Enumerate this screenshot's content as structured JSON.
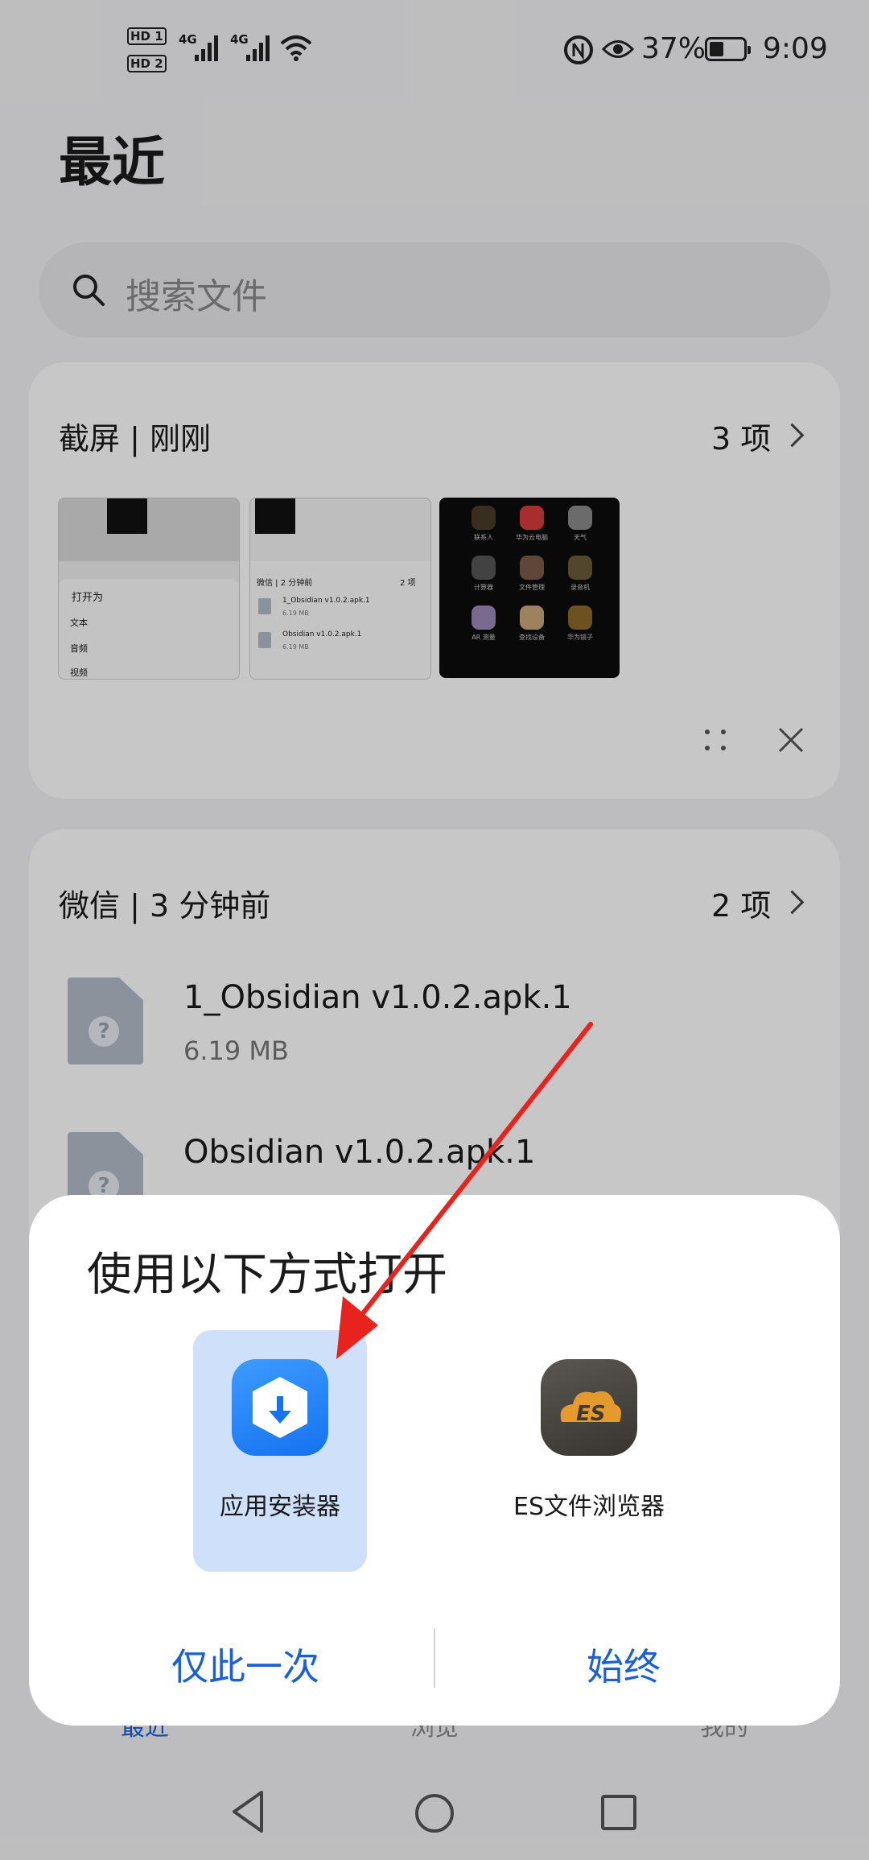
{
  "status_bar": {
    "sim1": "HD 1",
    "sim2": "HD 2",
    "network1": "4G",
    "network2": "4G",
    "battery": "37%",
    "time": "9:09"
  },
  "page": {
    "title": "最近",
    "search_placeholder": "搜索文件"
  },
  "screenshot_group": {
    "title": "截屏 | 刚刚",
    "count": "3 项",
    "thumb1": {
      "header": "打开为",
      "items": [
        "文本",
        "音频",
        "视频"
      ]
    },
    "thumb2": {
      "header": "微信 | 2 分钟前",
      "count": "2 项",
      "files": [
        {
          "name": "1_Obsidian v1.0.2.apk.1",
          "size": "6.19 MB"
        },
        {
          "name": "Obsidian v1.0.2.apk.1",
          "size": "6.19 MB"
        }
      ]
    },
    "thumb3": {
      "apps": [
        "联系人",
        "华为云电脑",
        "天气",
        "计算器",
        "文件管理",
        "录音机",
        "AR 测量",
        "查找设备",
        "华为镜子"
      ]
    }
  },
  "wechat_group": {
    "title": "微信 | 3 分钟前",
    "count": "2 项",
    "files": [
      {
        "name": "1_Obsidian v1.0.2.apk.1",
        "size": "6.19 MB"
      },
      {
        "name": "Obsidian v1.0.2.apk.1",
        "size": ""
      }
    ]
  },
  "bottom_tabs": [
    "最近",
    "浏览",
    "我的"
  ],
  "dialog": {
    "title": "使用以下方式打开",
    "apps": [
      {
        "label": "应用安装器",
        "icon": "app-installer-icon",
        "selected": true
      },
      {
        "label": "ES文件浏览器",
        "icon": "es-file-explorer-icon",
        "selected": false
      }
    ],
    "just_once": "仅此一次",
    "always": "始终"
  },
  "colors": {
    "accent": "#1a5fd6",
    "selected_bg": "#cfe0fb",
    "annotation_arrow": "#e8231e"
  }
}
